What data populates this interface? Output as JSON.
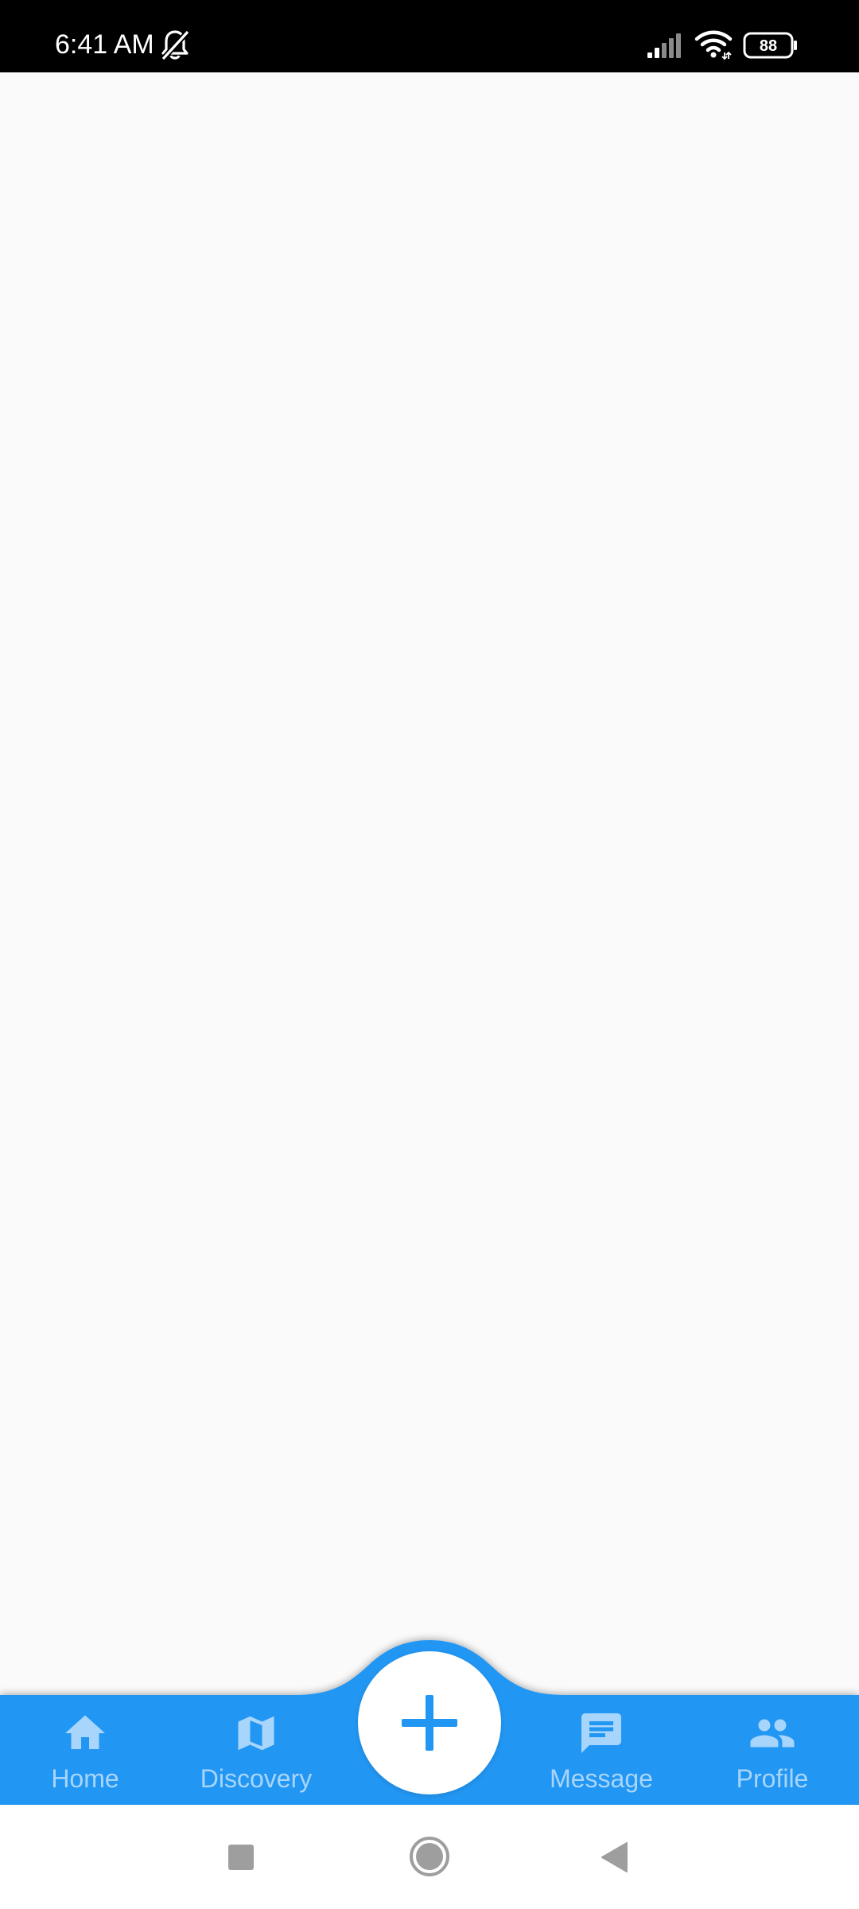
{
  "status_bar": {
    "time": "6:41 AM",
    "battery_level": "88",
    "icons": [
      "bell-off-icon",
      "signal-icon",
      "wifi-icon",
      "battery-icon"
    ]
  },
  "bottom_nav": {
    "background_color": "#2196f3",
    "item_color": "#a8d5fb",
    "items": [
      {
        "label": "Home",
        "icon": "home-icon"
      },
      {
        "label": "Discovery",
        "icon": "map-icon"
      },
      {
        "label": "Message",
        "icon": "message-icon"
      },
      {
        "label": "Profile",
        "icon": "people-icon"
      }
    ],
    "fab_icon": "plus-icon"
  },
  "system_nav": {
    "buttons": [
      "recents-button",
      "home-button",
      "back-button"
    ],
    "color": "#9e9e9e"
  }
}
